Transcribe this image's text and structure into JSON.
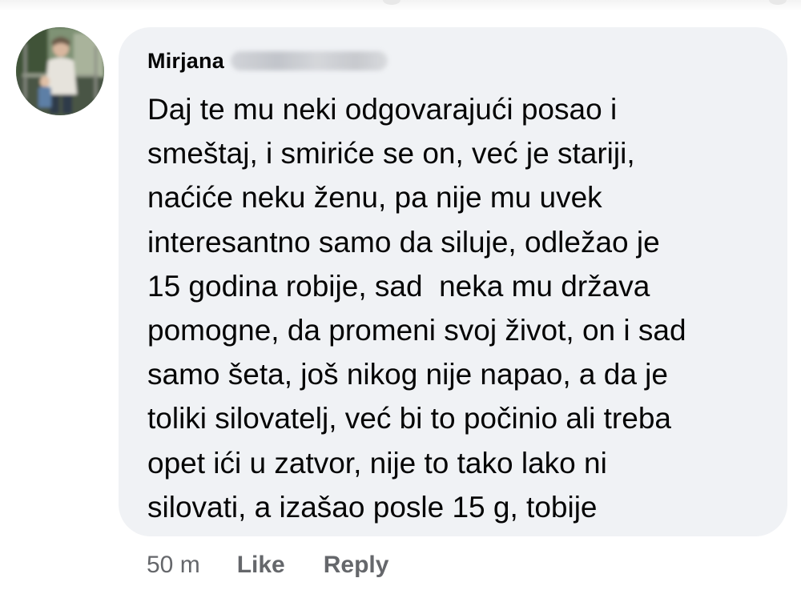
{
  "comment": {
    "author_name": "Mirjana",
    "text_lines": [
      "Daj te mu neki odgovarajući posao i",
      "smeštaj, i smiriće se on, već je stariji,",
      "naćiće neku ženu, pa nije mu uvek",
      "interesantno samo da siluje, odležao je",
      "15 godina robije, sad  neka mu država",
      "pomogne, da promeni svoj život, on i sad",
      "samo šeta, još nikog nije napao, a da je",
      "toliki silovatelj, već bi to počinio ali treba",
      "opet ići u zatvor, nije to tako lako ni",
      "silovati, a izašao posle 15 g, tobije"
    ],
    "timestamp": "50 m",
    "like_label": "Like",
    "reply_label": "Reply"
  },
  "colors": {
    "bubble_background": "#f0f2f5",
    "text_primary": "#050505",
    "text_secondary": "#65676b"
  },
  "icons": {
    "avatar": "profile-photo"
  }
}
